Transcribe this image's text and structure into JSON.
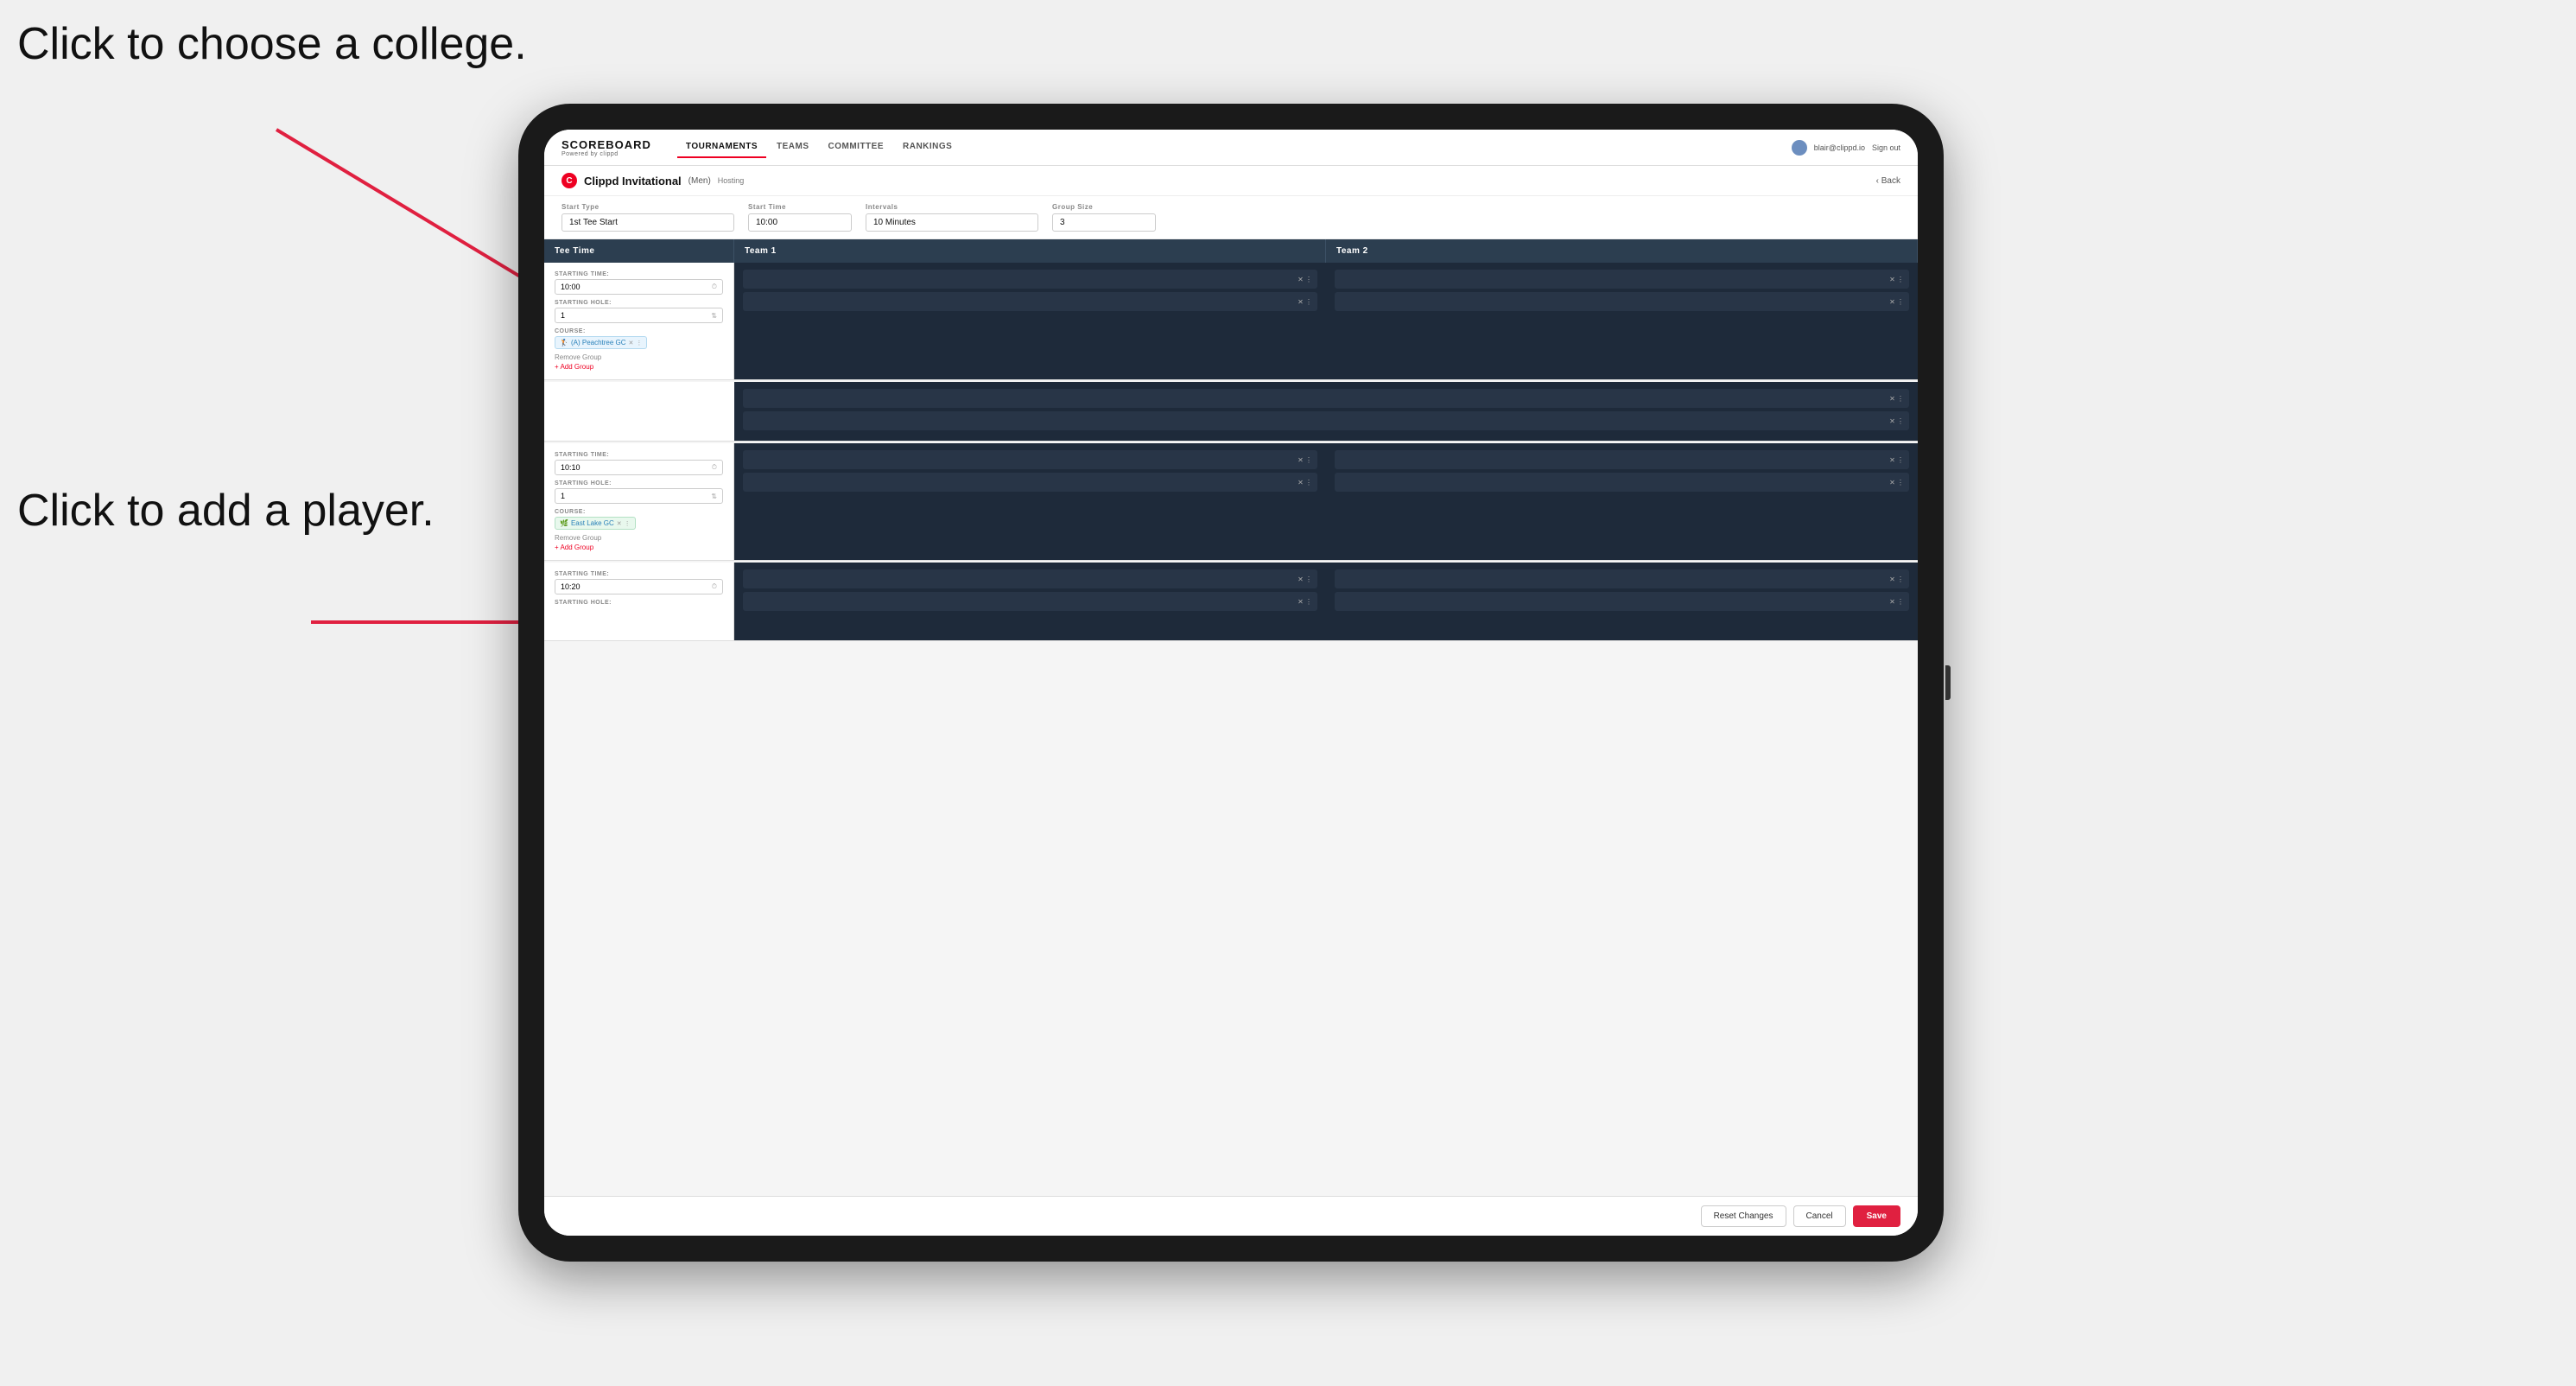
{
  "annotations": {
    "choose_college": "Click to choose a\ncollege.",
    "add_player": "Click to add\na player."
  },
  "nav": {
    "brand": "SCOREBOARD",
    "brand_sub": "Powered by clippd",
    "links": [
      "TOURNAMENTS",
      "TEAMS",
      "COMMITTEE",
      "RANKINGS"
    ],
    "active_link": "TOURNAMENTS",
    "user_email": "blair@clippd.io",
    "sign_out": "Sign out"
  },
  "page": {
    "icon": "C",
    "title": "Clippd Invitational",
    "subtitle": "(Men)",
    "hosting": "Hosting",
    "back": "Back"
  },
  "controls": {
    "start_type_label": "Start Type",
    "start_type_value": "1st Tee Start",
    "start_time_label": "Start Time",
    "start_time_value": "10:00",
    "intervals_label": "Intervals",
    "intervals_value": "10 Minutes",
    "group_size_label": "Group Size",
    "group_size_value": "3"
  },
  "table_headers": {
    "tee_time": "Tee Time",
    "team1": "Team 1",
    "team2": "Team 2"
  },
  "groups": [
    {
      "starting_time_label": "STARTING TIME:",
      "starting_time": "10:00",
      "starting_hole_label": "STARTING HOLE:",
      "starting_hole": "1",
      "course_label": "COURSE:",
      "course": "(A) Peachtree GC",
      "remove_group": "Remove Group",
      "add_group": "+ Add Group"
    },
    {
      "starting_time_label": "STARTING TIME:",
      "starting_time": "10:10",
      "starting_hole_label": "STARTING HOLE:",
      "starting_hole": "1",
      "course_label": "COURSE:",
      "course": "East Lake GC",
      "remove_group": "Remove Group",
      "add_group": "+ Add Group"
    },
    {
      "starting_time_label": "STARTING TIME:",
      "starting_time": "10:20",
      "starting_hole_label": "STARTING HOLE:",
      "starting_hole": "",
      "course_label": "",
      "course": "",
      "remove_group": "",
      "add_group": ""
    }
  ],
  "footer": {
    "reset": "Reset Changes",
    "cancel": "Cancel",
    "save": "Save"
  },
  "colors": {
    "brand_red": "#e02040",
    "nav_dark": "#2c3e50",
    "team_bg": "#1e2a3a",
    "player_bg": "#283547"
  }
}
